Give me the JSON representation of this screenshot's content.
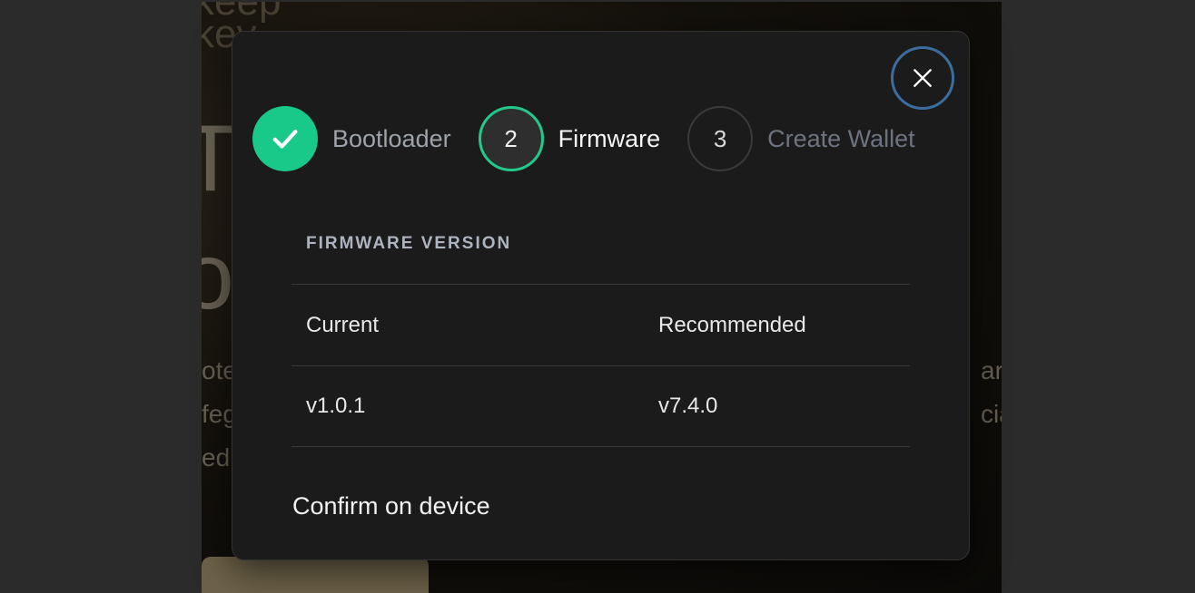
{
  "background": {
    "logo_text": "keep\nkey",
    "hero_fragment": "T\nof",
    "para_left": "ote\nfeg\ned",
    "para_right": "ar\ncia"
  },
  "modal": {
    "close_icon": "close-icon",
    "steps": [
      {
        "number": "",
        "label": "Bootloader",
        "state": "done",
        "icon": "check-icon"
      },
      {
        "number": "2",
        "label": "Firmware",
        "state": "active"
      },
      {
        "number": "3",
        "label": "Create Wallet",
        "state": "pending"
      }
    ],
    "section_title": "FIRMWARE VERSION",
    "table": {
      "headers": [
        "Current",
        "Recommended"
      ],
      "rows": [
        [
          "v1.0.1",
          "v7.4.0"
        ]
      ]
    },
    "confirm_text": "Confirm on device"
  },
  "colors": {
    "accent_green": "#18c98a",
    "close_ring": "#3b6e9e",
    "modal_bg": "#1b1b1b"
  }
}
